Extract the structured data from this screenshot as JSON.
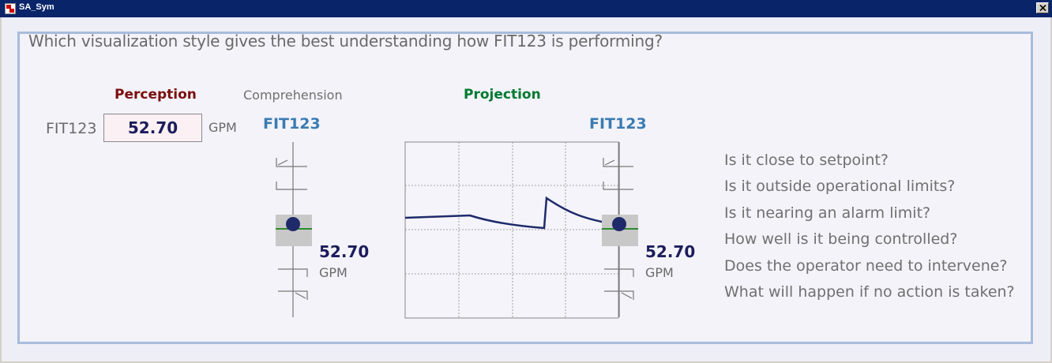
{
  "window": {
    "title": "SA_Sym"
  },
  "colors": {
    "titlebar": "#0a246a",
    "panel_border": "#a8bcdc",
    "perception": "#7b0d0d",
    "projection": "#007a30",
    "tag": "#3b7bb2",
    "value": "#1c1c5c",
    "setpoint_line": "#2e8b2e",
    "marker": "#1f2a6b"
  },
  "question": "Which visualization style gives the best understanding how FIT123 is performing?",
  "headers": {
    "perception": "Perception",
    "comprehension": "Comprehension",
    "projection": "Projection"
  },
  "perception": {
    "tag": "FIT123",
    "value": "52.70",
    "unit": "GPM"
  },
  "comprehension": {
    "tag": "FIT123",
    "value": "52.70",
    "unit": "GPM"
  },
  "projection": {
    "tag": "FIT123",
    "value": "52.70",
    "unit": "GPM"
  },
  "questions": [
    "Is it close to setpoint?",
    "Is it outside operational limits?",
    "Is it nearing an alarm limit?",
    "How well is it being controlled?",
    "Does the operator need to intervene?",
    "What will happen if no action is taken?"
  ],
  "icons": {
    "window": "app-icon",
    "close": "close-icon"
  }
}
